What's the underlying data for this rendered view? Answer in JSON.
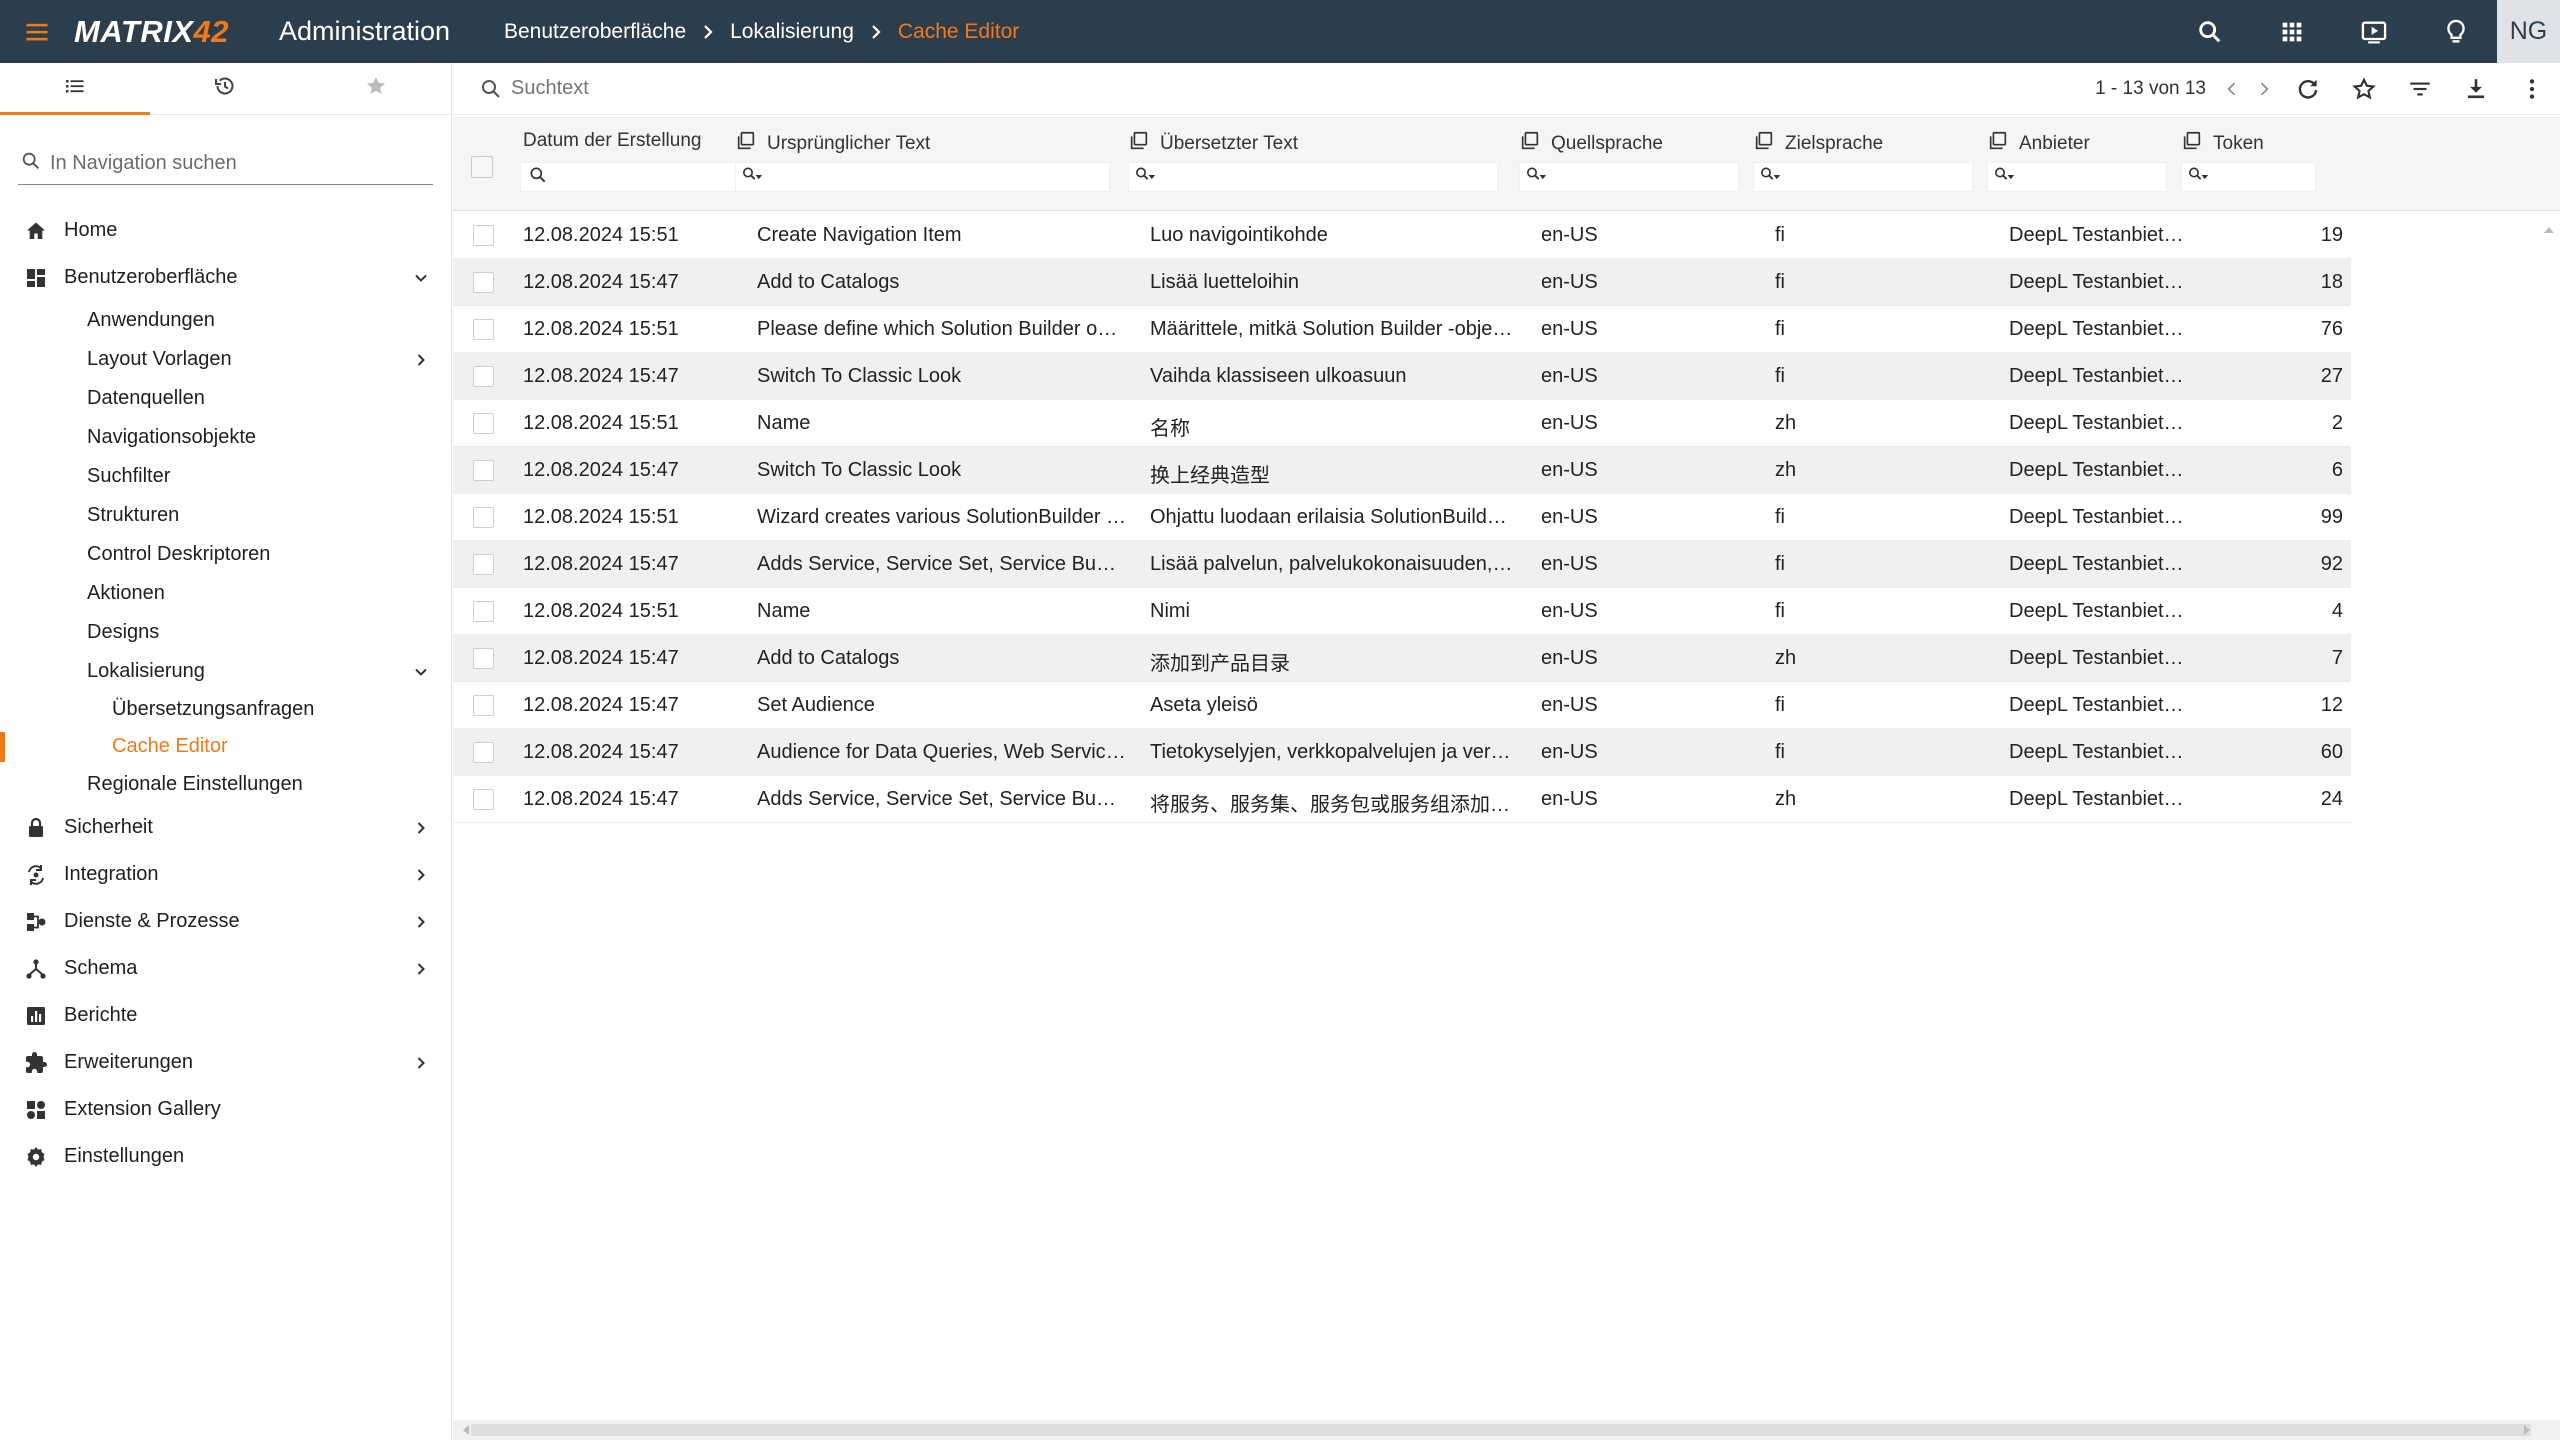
{
  "topbar": {
    "menu_icon": "hamburger-icon",
    "brand_main": "MATRIX",
    "brand_num": "42",
    "app_title": "Administration",
    "breadcrumbs": [
      "Benutzeroberfläche",
      "Lokalisierung",
      "Cache Editor"
    ],
    "right_icons": [
      "search-icon",
      "apps-grid-icon",
      "video-player-icon",
      "lightbulb-icon"
    ],
    "avatar": "NG",
    "colors": {
      "bar": "#2c3e4c",
      "accent": "#f07a1a"
    }
  },
  "sidebar": {
    "tabs": [
      "list-icon",
      "history-icon",
      "star-icon"
    ],
    "search_placeholder": "In Navigation suchen",
    "items": [
      {
        "label": "Home",
        "icon": "home-icon",
        "expandable": false
      },
      {
        "label": "Benutzeroberfläche",
        "icon": "dashboard-icon",
        "expanded": true,
        "children": [
          {
            "label": "Anwendungen"
          },
          {
            "label": "Layout Vorlagen",
            "expandable": true
          },
          {
            "label": "Datenquellen"
          },
          {
            "label": "Navigationsobjekte"
          },
          {
            "label": "Suchfilter"
          },
          {
            "label": "Strukturen"
          },
          {
            "label": "Control Deskriptoren"
          },
          {
            "label": "Aktionen"
          },
          {
            "label": "Designs"
          },
          {
            "label": "Lokalisierung",
            "expanded": true,
            "children": [
              {
                "label": "Übersetzungsanfragen"
              },
              {
                "label": "Cache Editor",
                "active": true
              }
            ]
          },
          {
            "label": "Regionale Einstellungen"
          }
        ]
      },
      {
        "label": "Sicherheit",
        "icon": "lock-icon",
        "expandable": true
      },
      {
        "label": "Integration",
        "icon": "integration-icon",
        "expandable": true
      },
      {
        "label": "Dienste & Prozesse",
        "icon": "services-icon",
        "expandable": true
      },
      {
        "label": "Schema",
        "icon": "schema-icon",
        "expandable": true
      },
      {
        "label": "Berichte",
        "icon": "reports-icon",
        "expandable": false
      },
      {
        "label": "Erweiterungen",
        "icon": "puzzle-icon",
        "expandable": true
      },
      {
        "label": "Extension Gallery",
        "icon": "gallery-icon",
        "expandable": false
      },
      {
        "label": "Einstellungen",
        "icon": "gear-icon",
        "expandable": false
      }
    ]
  },
  "toolbar": {
    "search_placeholder": "Suchtext",
    "pager": "1 - 13 von 13",
    "icons": [
      "chevron-left-icon",
      "chevron-right-icon",
      "refresh-icon",
      "star-outline-icon",
      "filter-icon",
      "download-icon",
      "more-vert-icon"
    ]
  },
  "grid": {
    "columns": [
      "Datum der Erstellung",
      "Ursprünglicher Text",
      "Übersetzter Text",
      "Quellsprache",
      "Zielsprache",
      "Anbieter",
      "Token"
    ],
    "rows": [
      [
        "12.08.2024 15:51",
        "Create Navigation Item",
        "Luo navigointikohde",
        "en-US",
        "fi",
        "DeepL Testanbiet…",
        "19"
      ],
      [
        "12.08.2024 15:47",
        "Add to Catalogs",
        "Lisää luetteloihin",
        "en-US",
        "fi",
        "DeepL Testanbiet…",
        "18"
      ],
      [
        "12.08.2024 15:51",
        "Please define which Solution Builder obj…",
        "Määrittele, mitkä Solution Builder -objek…",
        "en-US",
        "fi",
        "DeepL Testanbiet…",
        "76"
      ],
      [
        "12.08.2024 15:47",
        "Switch To Classic Look",
        "Vaihda klassiseen ulkoasuun",
        "en-US",
        "fi",
        "DeepL Testanbiet…",
        "27"
      ],
      [
        "12.08.2024 15:51",
        "Name",
        "名称",
        "en-US",
        "zh",
        "DeepL Testanbiet…",
        "2"
      ],
      [
        "12.08.2024 15:47",
        "Switch To Classic Look",
        "换上经典造型",
        "en-US",
        "zh",
        "DeepL Testanbiet…",
        "6"
      ],
      [
        "12.08.2024 15:51",
        "Wizard creates various SolutionBuilder …",
        "Ohjattu luodaan erilaisia SolutionBuilder…",
        "en-US",
        "fi",
        "DeepL Testanbiet…",
        "99"
      ],
      [
        "12.08.2024 15:47",
        "Adds Service, Service Set, Service Bundl…",
        "Lisää palvelun, palvelukokonaisuuden, p…",
        "en-US",
        "fi",
        "DeepL Testanbiet…",
        "92"
      ],
      [
        "12.08.2024 15:51",
        "Name",
        "Nimi",
        "en-US",
        "fi",
        "DeepL Testanbiet…",
        "4"
      ],
      [
        "12.08.2024 15:47",
        "Add to Catalogs",
        "添加到产品目录",
        "en-US",
        "zh",
        "DeepL Testanbiet…",
        "7"
      ],
      [
        "12.08.2024 15:47",
        "Set Audience",
        "Aseta yleisö",
        "en-US",
        "fi",
        "DeepL Testanbiet…",
        "12"
      ],
      [
        "12.08.2024 15:47",
        "Audience for Data Queries, Web Service…",
        "Tietokyselyjen, verkkopalvelujen ja verk…",
        "en-US",
        "fi",
        "DeepL Testanbiet…",
        "60"
      ],
      [
        "12.08.2024 15:47",
        "Adds Service, Service Set, Service Bundl…",
        "将服务、服务集、服务包或服务组添加…",
        "en-US",
        "zh",
        "DeepL Testanbiet…",
        "24"
      ]
    ]
  }
}
